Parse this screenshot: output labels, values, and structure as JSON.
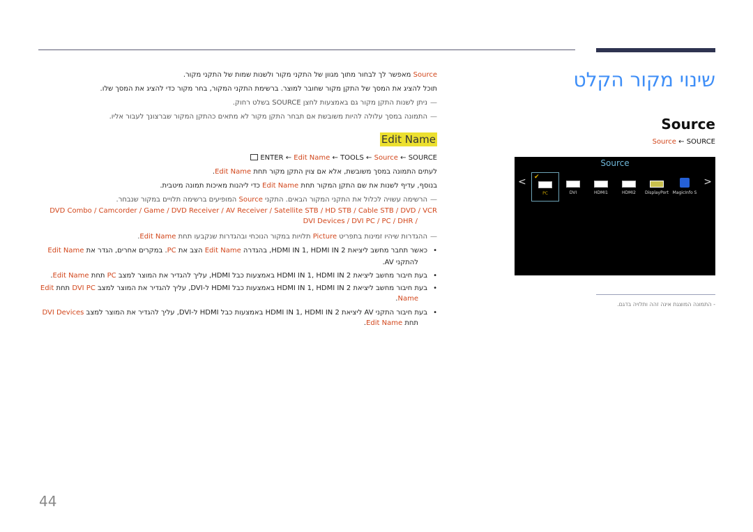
{
  "page": {
    "title": "שינוי מקור הקלט",
    "page_number": "44"
  },
  "source_section": {
    "heading": "Source",
    "path": {
      "red": "Source",
      "sep": " ← ",
      "plain": "SOURCE"
    }
  },
  "osd": {
    "title": "Source",
    "left_arrow": "<",
    "right_arrow": ">",
    "items": [
      {
        "label": "PC",
        "selected": true
      },
      {
        "label": "DVI",
        "selected": false
      },
      {
        "label": "HDMI1",
        "selected": false
      },
      {
        "label": "HDMI2",
        "selected": false
      },
      {
        "label": "DisplayPort",
        "selected": false
      },
      {
        "label": "MagicInfo S",
        "selected": false
      }
    ],
    "check": "✔"
  },
  "caption": "-   התמונה המוצגת אינה זהה ותלויה בדגם.",
  "intro": {
    "line1_red": "Source",
    "line1_rest": " מאפשר לך לבחור מתוך מגוון של התקני מקור ולשנות שמות של התקני מקור.",
    "line2": "תוכל להציג את המסך של התקן מקור שחובר למוצר. ברשימת התקני המקור, בחר מקור כדי להציג את המסך שלו.",
    "note1": "ניתן לשנות התקן מקור גם באמצעות לחצן SOURCE בשלט רחוק.",
    "note2": "התמונה במסך עלולה להיות משובשת אם תבחר התקן מקור לא מתאים כהתקן המקור שברצונך לעבור אליו."
  },
  "edit_name": {
    "heading": "Edit Name",
    "path": {
      "enter": "ENTER",
      "edit_name": "Edit Name",
      "tools": "TOOLS",
      "source_red": "Source",
      "source": "SOURCE",
      "sep": " ← "
    },
    "p1_a": "לעתים התמונה במסך משובשת, אלא אם צוין התקן מקור תחת ",
    "p1_red": "Edit Name",
    "p1_b": ".",
    "p2_a": "בנוסף, עדיף לשנות את שם התקן המקור תחת ",
    "p2_red": "Edit Name",
    "p2_b": " כדי ליהנות מאיכות תמונה מיטבית.",
    "note_list_a": "הרשימה עשויה לכלול את התקני המקור הבאים. התקני ",
    "note_list_red": "Source",
    "note_list_b": " המופיעים ברשימה תלויים במקור שנבחר.",
    "device_list_line1": "DVD Combo / Camcorder / Game / DVD Receiver / AV Receiver / Satellite STB / HD STB / Cable STB / DVD / VCR",
    "device_list_line2": "DVI Devices / DVI PC / PC / DHR /",
    "note_picture_a": "ההגדרות שיהיו זמינות בתפריט ",
    "note_picture_red": "Picture",
    "note_picture_b": " תלויות במקור הנוכחי ובהגדרות שנקבעו תחת ",
    "note_picture_red2": "Edit Name",
    "note_picture_c": ".",
    "bullets": [
      {
        "l1_a": "כאשר תחבר מחשב ליציאת HDMI IN 1, HDMI IN 2, בהגדרה ",
        "l1_r1": "Edit Name",
        "l1_b": " הצב את ",
        "l1_r2": "PC",
        "l1_c": ". במקרים אחרים, הגדר את ",
        "l1_r3": "Edit Name",
        "l2": "להתקני AV."
      },
      {
        "l1_a": "בעת חיבור מחשב ליציאת HDMI IN 1, HDMI IN 2 באמצעות כבל HDMI, עליך להגדיר את המוצר למצב ",
        "l1_r1": "PC",
        "l1_b": " תחת ",
        "l1_r2": "Edit Name",
        "l1_c": "."
      },
      {
        "l1_a": "בעת חיבור מחשב ליציאת HDMI IN 1, HDMI IN 2 באמצעות כבל HDMI ל-DVI, עליך להגדיר את המוצר למצב ",
        "l1_r1": "DVI PC",
        "l1_b": " תחת ",
        "l1_r2": "Edit",
        "l2_red": "Name",
        "l2_b": "."
      },
      {
        "l1_a": "בעת חיבור התקני AV ליציאת HDMI IN 1, HDMI IN 2 באמצעות כבל HDMI ל-DVI, עליך להגדיר את המוצר למצב ",
        "l1_r1": "DVI Devices",
        "l2_a": "תחת ",
        "l2_red": "Edit Name",
        "l2_b": "."
      }
    ],
    "bullet_glyph": "•",
    "note_glyph": "—"
  },
  "colors": {
    "title_blue": "#3e8ef7",
    "accent_red": "#d2461b",
    "highlight_yellow": "#ece02f",
    "rule_navy": "#2e3350"
  }
}
